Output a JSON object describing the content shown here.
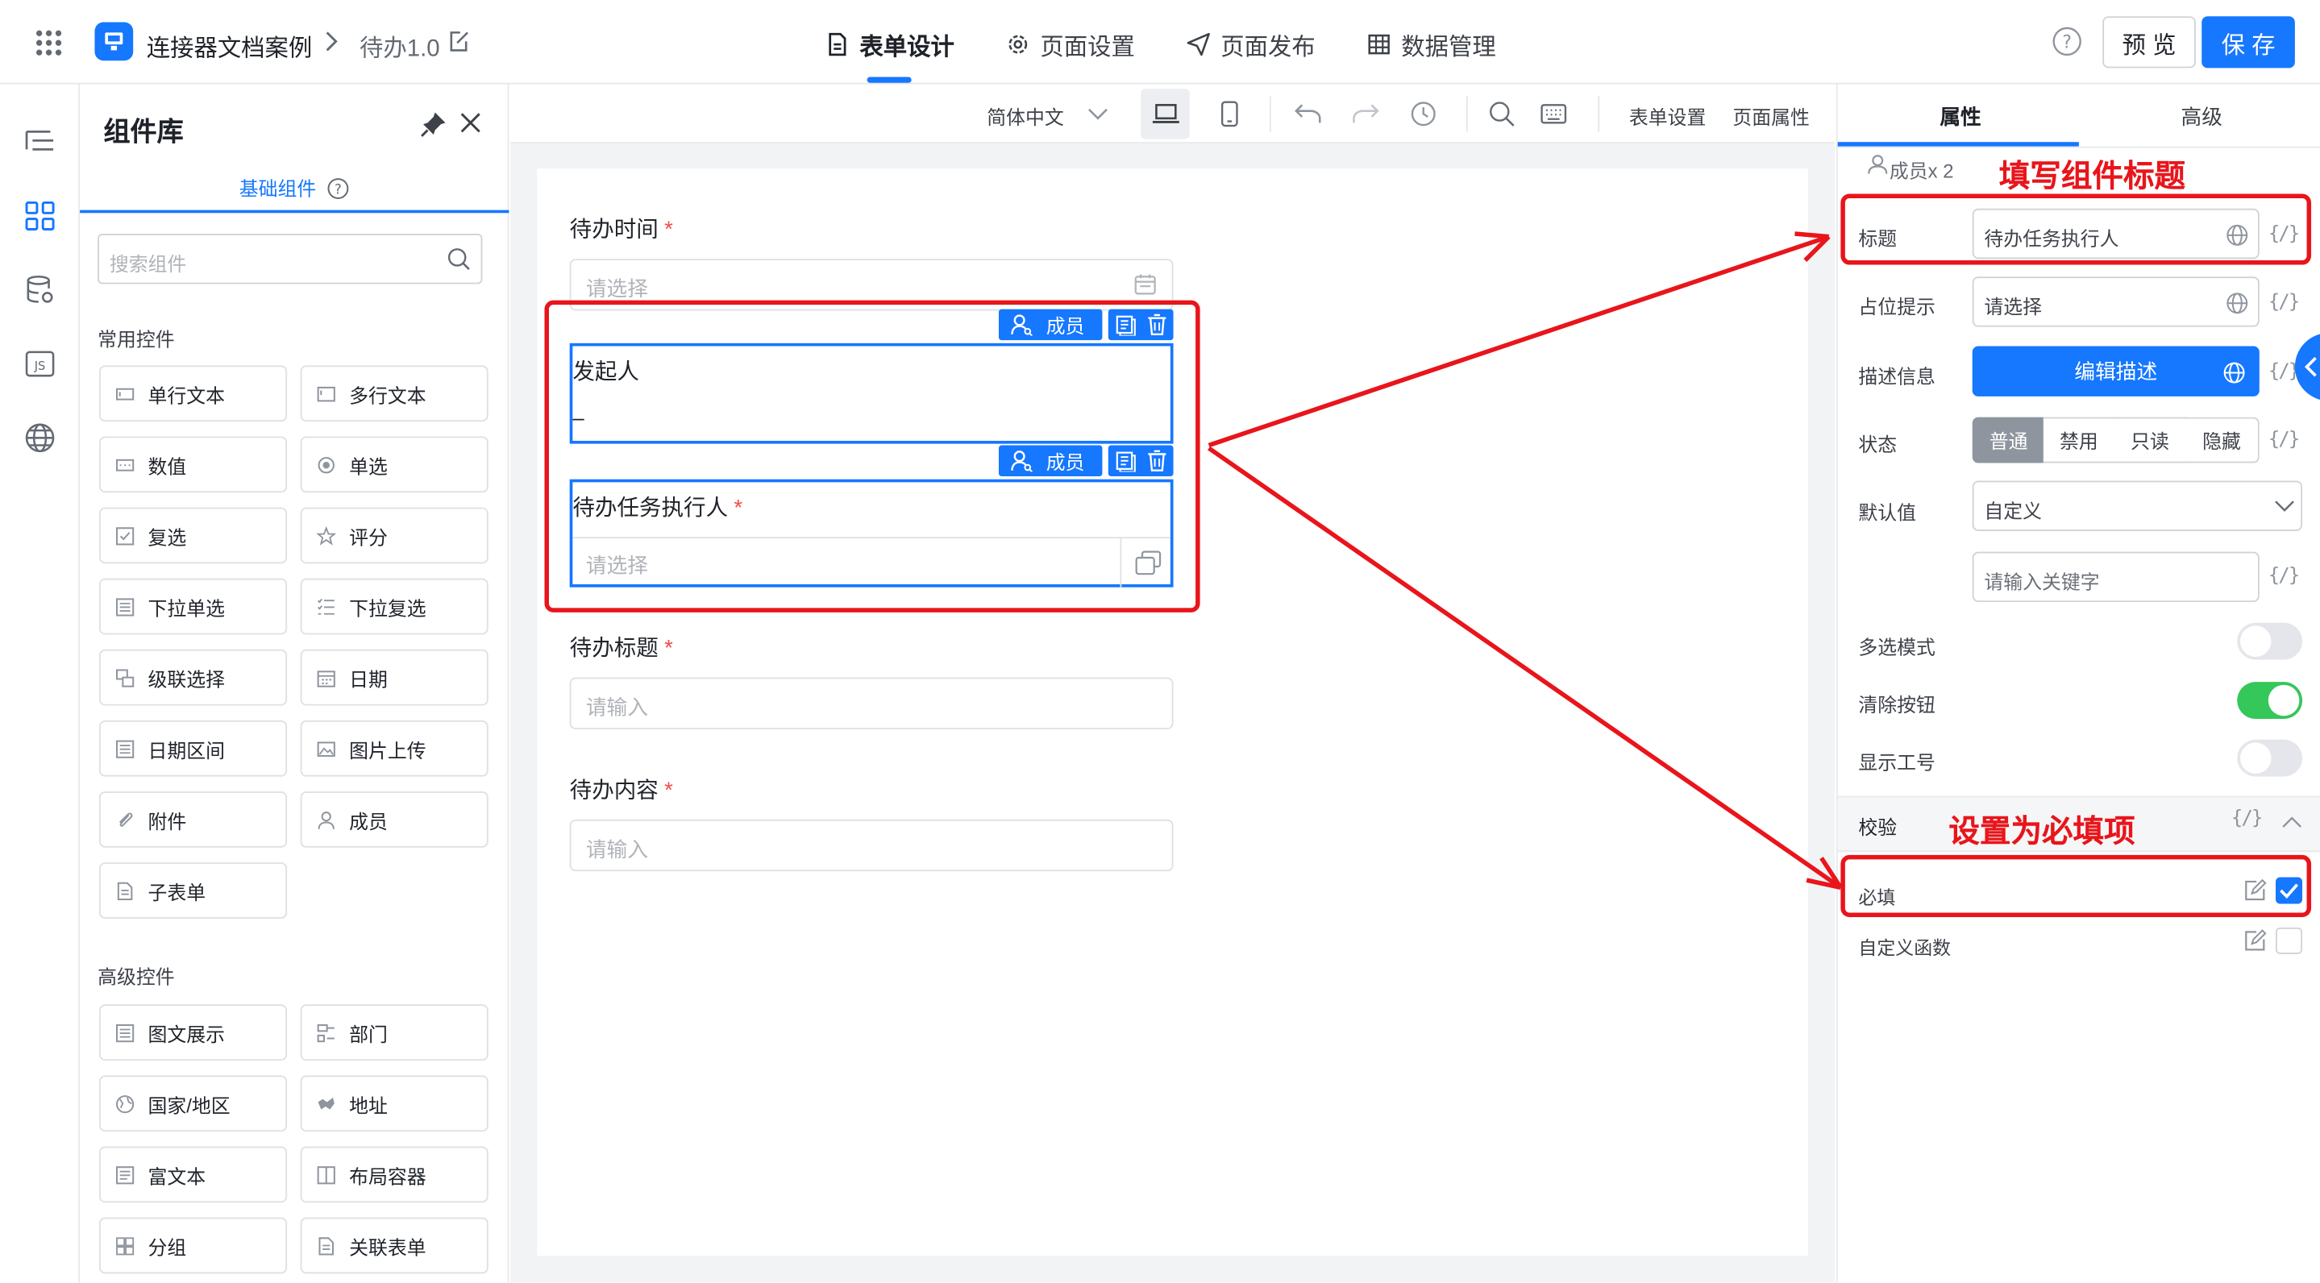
{
  "app": {
    "project_name": "连接器文档案例",
    "version_name": "待办1.0",
    "nav_tabs": [
      {
        "label": "表单设计",
        "active": true
      },
      {
        "label": "页面设置",
        "active": false
      },
      {
        "label": "页面发布",
        "active": false
      },
      {
        "label": "数据管理",
        "active": false
      }
    ],
    "preview_label": "预 览",
    "save_label": "保 存",
    "accent_color": "#1677ff"
  },
  "library": {
    "title": "组件库",
    "tab_label": "基础组件",
    "search_placeholder": "搜索组件",
    "sections": [
      {
        "title": "常用控件",
        "items": [
          {
            "label": "单行文本",
            "icon": "single-line-text-icon"
          },
          {
            "label": "多行文本",
            "icon": "multi-line-text-icon"
          },
          {
            "label": "数值",
            "icon": "number-icon"
          },
          {
            "label": "单选",
            "icon": "radio-icon"
          },
          {
            "label": "复选",
            "icon": "checkbox-icon"
          },
          {
            "label": "评分",
            "icon": "star-icon"
          },
          {
            "label": "下拉单选",
            "icon": "dropdown-icon"
          },
          {
            "label": "下拉复选",
            "icon": "multi-dropdown-icon"
          },
          {
            "label": "级联选择",
            "icon": "cascade-icon"
          },
          {
            "label": "日期",
            "icon": "calendar-icon"
          },
          {
            "label": "日期区间",
            "icon": "date-range-icon"
          },
          {
            "label": "图片上传",
            "icon": "image-icon"
          },
          {
            "label": "附件",
            "icon": "paperclip-icon"
          },
          {
            "label": "成员",
            "icon": "user-icon"
          },
          {
            "label": "子表单",
            "icon": "subform-icon"
          }
        ]
      },
      {
        "title": "高级控件",
        "items": [
          {
            "label": "图文展示",
            "icon": "rich-display-icon"
          },
          {
            "label": "部门",
            "icon": "department-icon"
          },
          {
            "label": "国家/地区",
            "icon": "globe-icon"
          },
          {
            "label": "地址",
            "icon": "map-icon"
          },
          {
            "label": "富文本",
            "icon": "rich-text-icon"
          },
          {
            "label": "布局容器",
            "icon": "layout-icon"
          },
          {
            "label": "分组",
            "icon": "group-icon"
          },
          {
            "label": "关联表单",
            "icon": "link-form-icon"
          }
        ]
      }
    ]
  },
  "toolbar": {
    "language": "简体中文",
    "form_settings": "表单设置",
    "page_properties": "页面属性"
  },
  "form": {
    "fields": [
      {
        "label": "待办时间",
        "required": true,
        "placeholder": "请选择"
      },
      {
        "label": "发起人",
        "required": false,
        "value": "–",
        "chip": "成员"
      },
      {
        "label": "待办任务执行人",
        "required": true,
        "placeholder": "请选择",
        "chip": "成员"
      },
      {
        "label": "待办标题",
        "required": true,
        "placeholder": "请输入"
      },
      {
        "label": "待办内容",
        "required": true,
        "placeholder": "请输入"
      }
    ],
    "required_mark": "*"
  },
  "panel": {
    "tabs": [
      {
        "label": "属性",
        "active": true
      },
      {
        "label": "高级",
        "active": false
      }
    ],
    "component_info": "成员x 2",
    "title_label": "标题",
    "title_value": "待办任务执行人",
    "placeholder_label": "占位提示",
    "placeholder_value": "请选择",
    "desc_label": "描述信息",
    "desc_button": "编辑描述",
    "state_label": "状态",
    "state_options": [
      "普通",
      "禁用",
      "只读",
      "隐藏"
    ],
    "state_selected": "普通",
    "default_label": "默认值",
    "default_value": "自定义",
    "keyword_placeholder": "请输入关键字",
    "multi_mode_label": "多选模式",
    "multi_mode_on": false,
    "clear_button_label": "清除按钮",
    "clear_button_on": true,
    "show_id_label": "显示工号",
    "show_id_on": false,
    "validation_label": "校验",
    "required_label": "必填",
    "required_checked": true,
    "custom_fn_label": "自定义函数",
    "custom_fn_checked": false,
    "fx_label": "{/}"
  },
  "annotations": {
    "title_hint": "填写组件标题",
    "required_hint": "设置为必填项",
    "color": "#e8151b"
  }
}
